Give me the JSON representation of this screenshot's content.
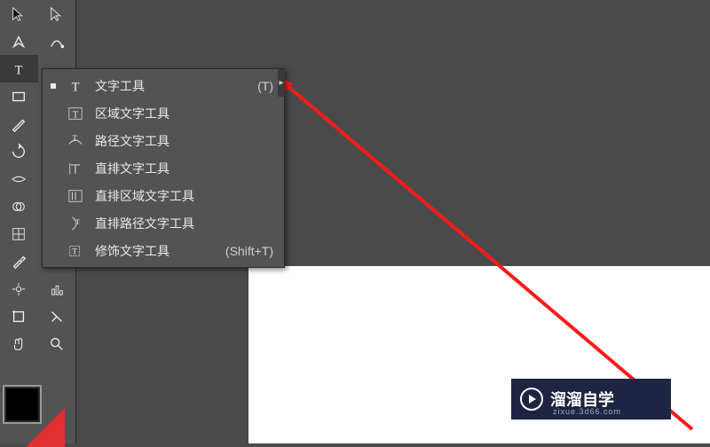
{
  "toolbar": {
    "rows": [
      [
        "pointer-icon",
        "magic-wand-icon"
      ],
      [
        "pen-icon",
        "brush-icon"
      ],
      [
        "type-icon",
        ""
      ],
      [
        "rectangle-icon",
        ""
      ],
      [
        "line-icon",
        ""
      ],
      [
        "pencil-icon",
        ""
      ],
      [
        "scale-icon",
        ""
      ],
      [
        "warp-icon",
        ""
      ],
      [
        "shape-builder-icon",
        "mesh-icon"
      ],
      [
        "eyedropper-icon",
        "gradient-icon"
      ],
      [
        "symbol-icon",
        "graph-icon"
      ],
      [
        "artboard-icon",
        "slice-icon"
      ],
      [
        "hand-icon",
        "zoom-icon"
      ]
    ]
  },
  "flyout": {
    "items": [
      {
        "icon": "T",
        "label": "文字工具",
        "shortcut": "(T)",
        "selected": true
      },
      {
        "icon": "区",
        "label": "区域文字工具",
        "shortcut": ""
      },
      {
        "icon": "路",
        "label": "路径文字工具",
        "shortcut": ""
      },
      {
        "icon": "直",
        "label": "直排文字工具",
        "shortcut": ""
      },
      {
        "icon": "直区",
        "label": "直排区域文字工具",
        "shortcut": ""
      },
      {
        "icon": "直路",
        "label": "直排路径文字工具",
        "shortcut": ""
      },
      {
        "icon": "修",
        "label": "修饰文字工具",
        "shortcut": "(Shift+T)"
      }
    ]
  },
  "watermark": {
    "title": "溜溜自学",
    "sub": "zixue.3d66.com"
  }
}
